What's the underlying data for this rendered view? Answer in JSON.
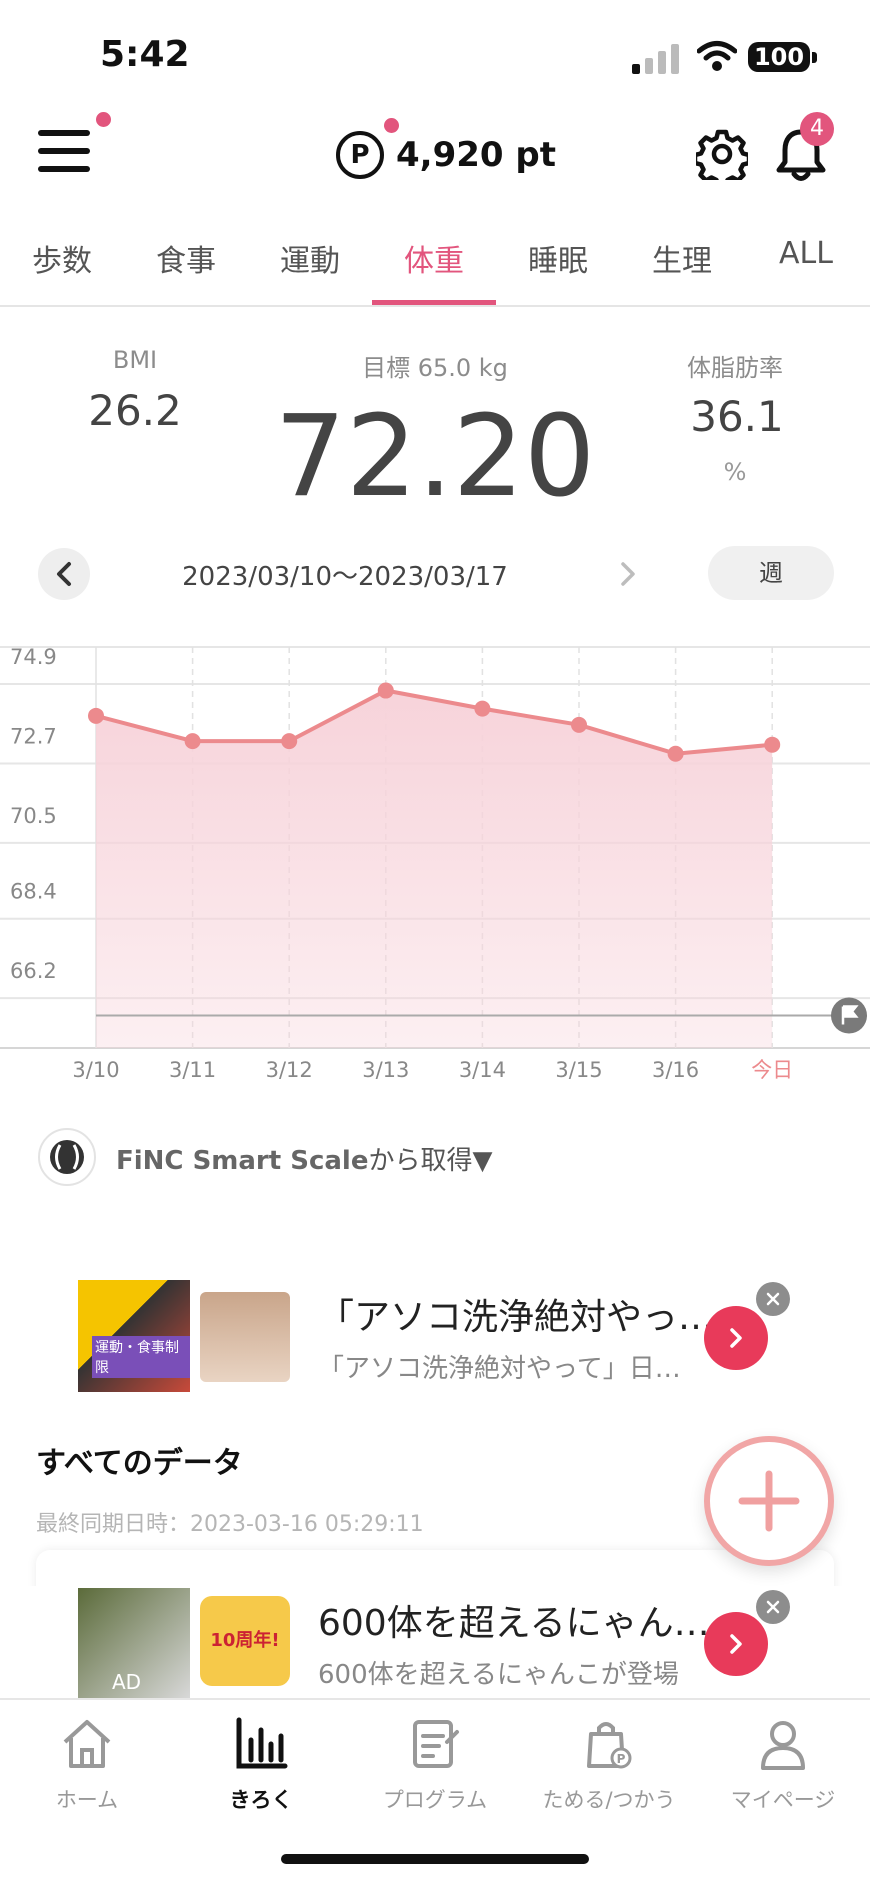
{
  "status_bar": {
    "time": "5:42",
    "battery": "100"
  },
  "header": {
    "points": "4,920 pt",
    "points_symbol": "P",
    "notification_count": "4"
  },
  "tabs": [
    {
      "label": "歩数"
    },
    {
      "label": "食事"
    },
    {
      "label": "運動"
    },
    {
      "label": "体重",
      "active": true
    },
    {
      "label": "睡眠"
    },
    {
      "label": "生理"
    },
    {
      "label": "ALL"
    }
  ],
  "metrics": {
    "bmi_label": "BMI",
    "bmi_value": "26.2",
    "goal_label": "目標 65.0 kg",
    "weight": "72.20",
    "fat_label": "体脂肪率",
    "fat_value": "36.1",
    "fat_unit": "%"
  },
  "date_nav": {
    "range": "2023/03/10〜2023/03/17",
    "period": "週"
  },
  "chart_data": {
    "type": "line",
    "categories": [
      "3/10",
      "3/11",
      "3/12",
      "3/13",
      "3/14",
      "3/15",
      "3/16",
      "今日"
    ],
    "values": [
      73.3,
      72.6,
      72.6,
      74.0,
      73.5,
      73.05,
      72.25,
      72.5
    ],
    "y_ticks": [
      "74.9",
      "72.7",
      "70.5",
      "68.4",
      "66.2"
    ],
    "y_tick_values": [
      74.9,
      72.7,
      70.5,
      68.4,
      66.2
    ],
    "ylim": [
      64.1,
      75.4
    ],
    "goal_line": 65.0,
    "colors": {
      "line": "#ec8a8d",
      "fill": "#f7d3da",
      "today_label": "#ec8a8d"
    },
    "grid": true
  },
  "source": {
    "brand": "FiNC Smart Scale",
    "suffix": "から取得▼"
  },
  "ad1": {
    "title": "「アソコ洗浄絶対やっ…",
    "subtitle": "「アソコ洗浄絶対やって」日…",
    "thumb_caption": "運動・食事制限"
  },
  "all_data": {
    "title": "すべてのデータ",
    "sync": "最終同期日時：2023-03-16 05:29:11"
  },
  "ad2": {
    "title": "600体を超えるにゃん…",
    "subtitle": "600体を超えるにゃんこが登場",
    "badge": "AD",
    "thumb_caption": "10周年!"
  },
  "bottom_nav": [
    {
      "label": "ホーム",
      "icon": "home-icon"
    },
    {
      "label": "きろく",
      "icon": "chart-bars-icon",
      "active": true
    },
    {
      "label": "プログラム",
      "icon": "program-icon"
    },
    {
      "label": "ためる/つかう",
      "icon": "shopping-bag-icon"
    },
    {
      "label": "マイページ",
      "icon": "person-icon"
    }
  ]
}
